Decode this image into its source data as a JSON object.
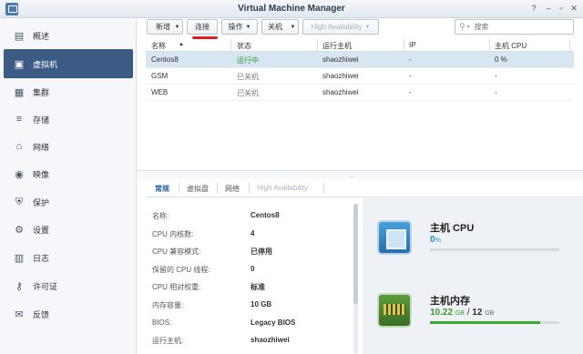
{
  "window": {
    "title": "Virtual Machine Manager"
  },
  "sidebar": {
    "items": [
      {
        "label": "概述",
        "icon": "overview-icon"
      },
      {
        "label": "虚拟机",
        "icon": "vm-icon",
        "active": true
      },
      {
        "label": "集群",
        "icon": "cluster-icon"
      },
      {
        "label": "存储",
        "icon": "storage-icon"
      },
      {
        "label": "网络",
        "icon": "network-icon"
      },
      {
        "label": "映像",
        "icon": "image-icon"
      },
      {
        "label": "保护",
        "icon": "shield-icon"
      },
      {
        "label": "设置",
        "icon": "gear-icon"
      },
      {
        "label": "日志",
        "icon": "log-icon"
      },
      {
        "label": "许可证",
        "icon": "key-icon"
      },
      {
        "label": "反馈",
        "icon": "feedback-icon"
      }
    ]
  },
  "toolbar": {
    "new_label": "新增",
    "connect_label": "连接",
    "action_label": "操作",
    "shutdown_label": "关机",
    "ha_label": "High Availability",
    "search_placeholder": "搜索"
  },
  "table": {
    "headers": [
      "名称",
      "状态",
      "运行主机",
      "IP",
      "主机 CPU"
    ],
    "rows": [
      {
        "name": "Centos8",
        "status": "运行中",
        "host": "shaozhiwei",
        "ip": "-",
        "cpu": "0 %"
      },
      {
        "name": "GSM",
        "status": "已关机",
        "host": "shaozhiwei",
        "ip": "-",
        "cpu": "-"
      },
      {
        "name": "WEB",
        "status": "已关机",
        "host": "shaozhiwei",
        "ip": "-",
        "cpu": "-"
      }
    ]
  },
  "detail_tabs": [
    "常规",
    "虚拟盘",
    "网络",
    "High Availability"
  ],
  "properties": [
    {
      "key": "名称:",
      "value": "Centos8"
    },
    {
      "key": "CPU 内核数:",
      "value": "4"
    },
    {
      "key": "CPU 兼容模式:",
      "value": "已停用"
    },
    {
      "key": "保留的 CPU 线程:",
      "value": "0"
    },
    {
      "key": "CPU 相对权重:",
      "value": "标准"
    },
    {
      "key": "内存容量:",
      "value": "10 GB"
    },
    {
      "key": "BIOS:",
      "value": "Legacy BIOS"
    },
    {
      "key": "运行主机:",
      "value": "shaozhiwei"
    }
  ],
  "resources": {
    "cpu": {
      "title": "主机 CPU",
      "value": "0",
      "unit": "%",
      "usage_fraction": 0.0
    },
    "memory": {
      "title": "主机内存",
      "used": "10.22",
      "used_unit": "GB",
      "sep": "/",
      "total": "12",
      "total_unit": "GB",
      "usage_fraction": 0.85
    }
  },
  "colors": {
    "accent": "#3b5b85",
    "running": "#2f9a2f",
    "cpu": "#1f8ac8",
    "memory": "#3aaa2a"
  }
}
